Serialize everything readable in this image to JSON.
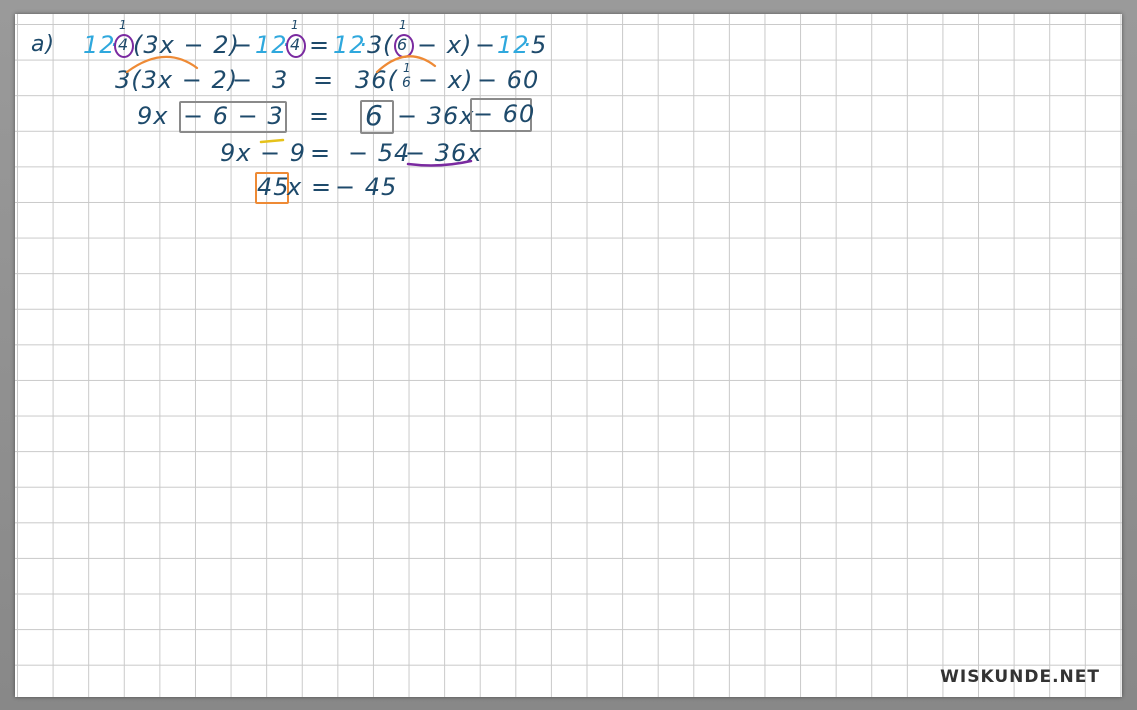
{
  "colors": {
    "ink": "#1e4a6b",
    "cyan": "#2fa8dd",
    "orange": "#ee8a35",
    "purple": "#7a2aa0",
    "box_gray": "#8a8a8a",
    "underline_yellow": "#e6c21a",
    "grid": "#c9c9c9"
  },
  "label": "a)",
  "line1": {
    "c1": "12",
    "dot1": "·",
    "small1_num": "1",
    "small1_den": "4",
    "paren1": "(3x − 2)",
    "minus1": "−",
    "c2": "12",
    "dot2": "·",
    "small2_num": "1",
    "small2_den": "4",
    "eq": "=",
    "c3": "12",
    "dot3": "·",
    "three": "3",
    "open": "(",
    "small3_num": "1",
    "small3_den": "6",
    "rest": "− x)",
    "minus2": "−",
    "c4": "12",
    "dot4": "·",
    "five": "5"
  },
  "line2": {
    "lhs_a": "3(3x − 2)",
    "lhs_b": "−",
    "lhs_c": "3",
    "eq": "=",
    "rhs_a": "36(",
    "frac_num": "1",
    "frac_den": "6",
    "rhs_b": "− x)",
    "rhs_c": "− 60"
  },
  "line3": {
    "a": "9x",
    "b": "− 6   − 3",
    "eq": "=",
    "c": "6",
    "d": "− 36x",
    "e": "− 60"
  },
  "line4": {
    "a": "9x",
    "b": "− 9",
    "eq": "=",
    "c": "− 54",
    "d": "− 36x"
  },
  "line5": {
    "a": "45",
    "b": "x",
    "eq": "=",
    "c": "− 45"
  },
  "watermark": "WISKUNDE.NET"
}
